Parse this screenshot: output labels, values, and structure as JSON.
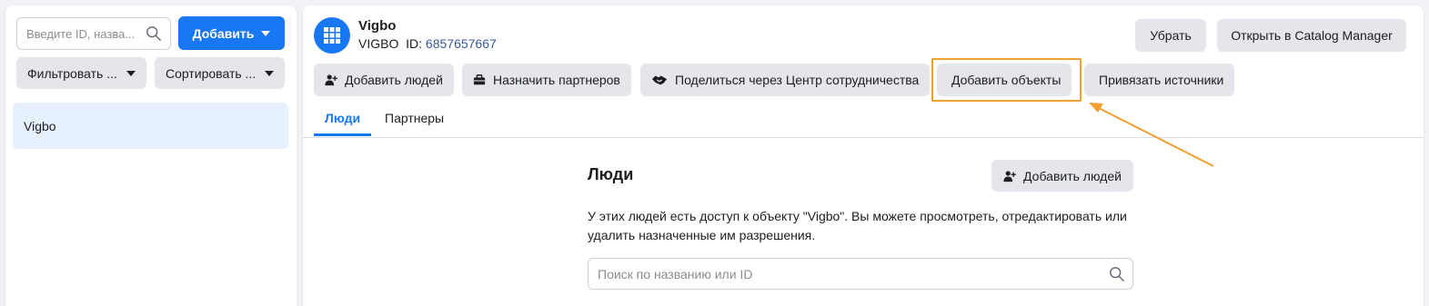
{
  "sidebar": {
    "search_placeholder": "Введите ID, назва...",
    "add_button": "Добавить",
    "filter_button": "Фильтровать ...",
    "sort_button": "Сортировать ...",
    "items": [
      {
        "label": "Vigbo"
      }
    ]
  },
  "asset": {
    "name": "Vigbo",
    "type_label": "VIGBO",
    "id_label": "ID:",
    "id_value": "6857657667",
    "icon": "grid-icon"
  },
  "header_actions": {
    "remove": "Убрать",
    "open_catalog_manager": "Открыть в Catalog Manager"
  },
  "action_buttons": {
    "add_people": "Добавить людей",
    "assign_partners": "Назначить партнеров",
    "share_collab_center": "Поделиться через Центр сотрудничества",
    "add_assets": "Добавить объекты",
    "link_sources": "Привязать источники"
  },
  "tabs": [
    {
      "label": "Люди",
      "active": true
    },
    {
      "label": "Партнеры",
      "active": false
    }
  ],
  "people_section": {
    "title": "Люди",
    "add_button": "Добавить людей",
    "description": "У этих людей есть доступ к объекту \"Vigbo\". Вы можете просмотреть, отредактировать или удалить назначенные им разрешения.",
    "search_placeholder": "Поиск по названию или ID"
  },
  "colors": {
    "accent": "#1877f2",
    "highlight": "#f0a030",
    "button_bg": "#e4e6eb",
    "selected_item_bg": "#e7f0fd"
  }
}
